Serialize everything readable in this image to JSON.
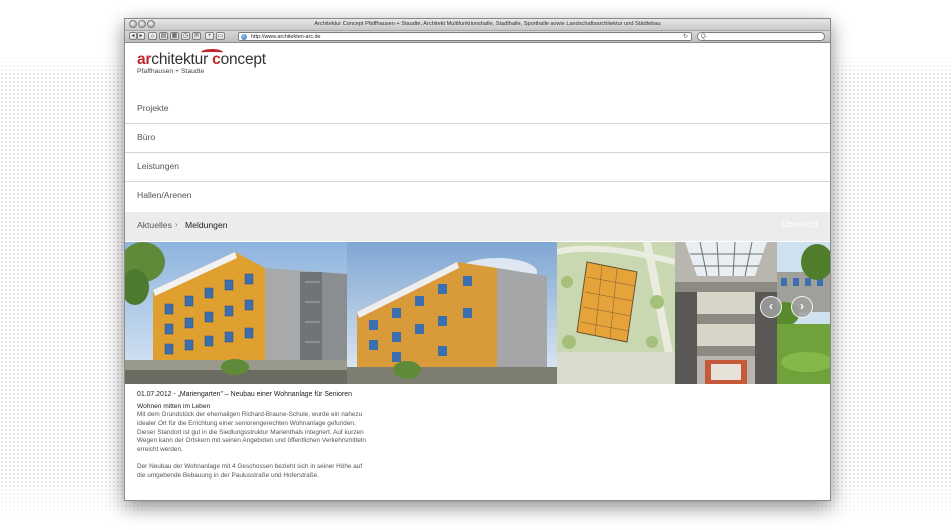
{
  "browser": {
    "window_title": "Architektur Concept Pfaffhausen + Staudte, Architekt Multifunktionshalle, Stadthalle, Sporthalle sowie Landschaftsarchitektur und Städtebau",
    "url": "http://www.architekten-arc.de",
    "search_glyph": "Q·"
  },
  "site": {
    "logo": {
      "part1": "ar",
      "part2": "chitektur",
      "part3": "c",
      "part4": "oncept",
      "subtitle": "Pfaffhausen + Staudte"
    },
    "nav": [
      "Projekte",
      "Büro",
      "Leistungen",
      "Hallen/Arenen"
    ],
    "breadcrumb": {
      "first": "Aktuelles",
      "separator": "›",
      "current": "Meldungen",
      "overview": "Übersicht"
    },
    "arrows": {
      "prev": "‹",
      "next": "›"
    },
    "article": {
      "headline": "01.07.2012 - „Mariengarten\" – Neubau einer Wohnanlage für Senioren",
      "subheading": "Wohnen mitten im Leben",
      "paragraph1": "Mit dem Grundstück der ehemaligen Richard-Braune-Schule, wurde ein nahezu idealer Ort für die Errichtung einer seniorengerechten Wohnanlage gefunden. Dieser Standort ist gut in die Siedlungsstruktur Marienthals integriert. Auf kurzen Wegen kann der Ortskern mit seinen Angeboten und öffentlichen Verkehrsmitteln erreicht werden.",
      "paragraph2": "Der Neubau der Wohnanlage mit 4 Geschossen bezieht sich in seiner Höhe auf die umgebende Bebauung in der Paulusstraße und Hoferstraße."
    }
  },
  "colors": {
    "accent_red": "#c0272d",
    "facade_orange": "#e0a030",
    "crumb_bg": "#ececec"
  }
}
